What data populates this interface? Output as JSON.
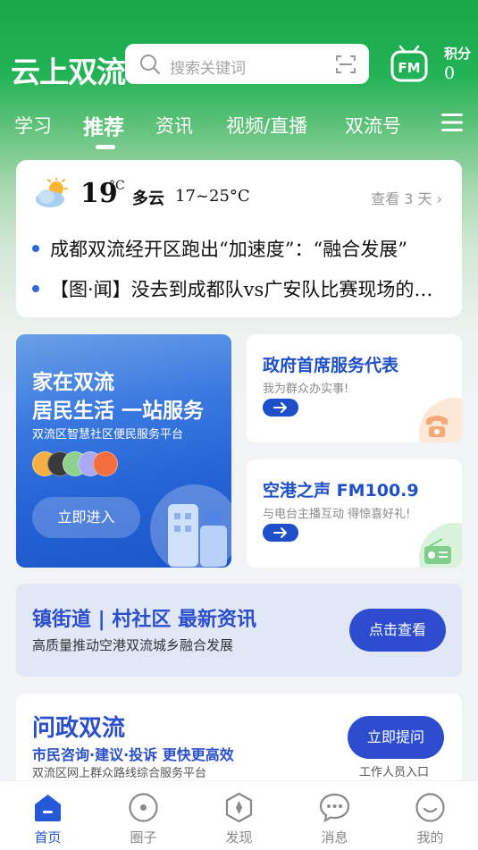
{
  "app": {
    "logo": "云上双流"
  },
  "search": {
    "placeholder": "搜索关键词"
  },
  "points": {
    "label": "积分",
    "value": "0"
  },
  "tabs": [
    {
      "label": "学习"
    },
    {
      "label": "推荐",
      "active": true
    },
    {
      "label": "资讯"
    },
    {
      "label": "视频/直播"
    },
    {
      "label": "双流号"
    }
  ],
  "weather": {
    "temp": "19",
    "unit": "°C",
    "condition": "多云",
    "range": "17~25°C",
    "more": "查看 3 天",
    "icon": "partly-cloudy-icon"
  },
  "news": [
    "成都双流经开区跑出“加速度”：“融合发展”",
    "【图·闻】没去到成都队vs广安队比赛现场的看过来"
  ],
  "community_card": {
    "line1": "家在双流",
    "line2": "居民生活 一站服务",
    "desc": "双流区智慧社区便民服务平台",
    "button": "立即进入",
    "avatar_colors": [
      "#f5b041",
      "#3a3a3a",
      "#8fd08f",
      "#a9a9f5",
      "#f46d3c"
    ]
  },
  "gov_card": {
    "title": "政府首席服务代表",
    "sub": "我为群众办实事!",
    "icon": "phone-icon"
  },
  "radio_card": {
    "title": "空港之声 FM100.9",
    "sub": "与电台主播互动 得惊喜好礼!",
    "icon": "radio-icon"
  },
  "town_card": {
    "title": "镇街道 | 村社区 最新资讯",
    "sub": "高质量推动空港双流城乡融合发展",
    "button": "点击查看"
  },
  "wenzheng_card": {
    "title": "问政双流",
    "line1": "市民咨询·建议·投诉 更快更高效",
    "line2": "双流区网上群众路线综合服务平台",
    "button": "立即提问",
    "staff": "工作人员入口"
  },
  "bottom_nav": [
    {
      "label": "首页",
      "icon": "home-icon",
      "active": true
    },
    {
      "label": "圈子",
      "icon": "circle-icon"
    },
    {
      "label": "发现",
      "icon": "compass-icon"
    },
    {
      "label": "消息",
      "icon": "message-icon"
    },
    {
      "label": "我的",
      "icon": "profile-icon"
    }
  ],
  "colors": {
    "brand_green": "#17a84a",
    "accent_blue": "#2e4dce"
  }
}
